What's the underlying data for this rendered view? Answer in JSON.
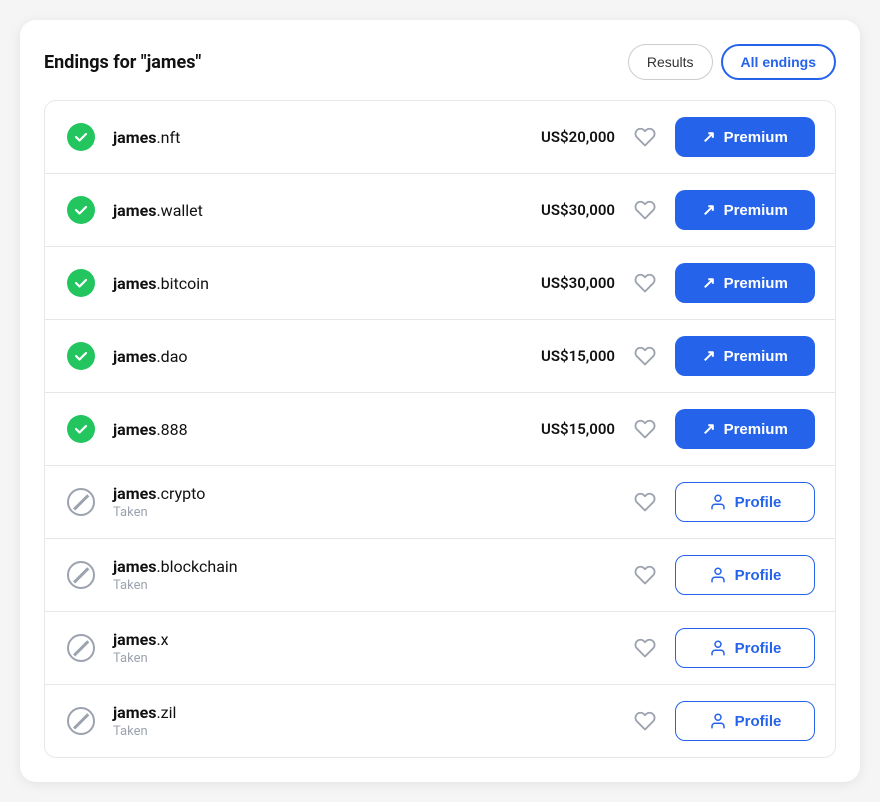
{
  "header": {
    "title_prefix": "Endings for ",
    "search_term": "\"james\"",
    "btn_results": "Results",
    "btn_all_endings": "All endings"
  },
  "domains": [
    {
      "id": "james-nft",
      "name_bold": "james",
      "name_ext": ".nft",
      "available": true,
      "price": "US$20,000",
      "action": "premium"
    },
    {
      "id": "james-wallet",
      "name_bold": "james",
      "name_ext": ".wallet",
      "available": true,
      "price": "US$30,000",
      "action": "premium"
    },
    {
      "id": "james-bitcoin",
      "name_bold": "james",
      "name_ext": ".bitcoin",
      "available": true,
      "price": "US$30,000",
      "action": "premium"
    },
    {
      "id": "james-dao",
      "name_bold": "james",
      "name_ext": ".dao",
      "available": true,
      "price": "US$15,000",
      "action": "premium"
    },
    {
      "id": "james-888",
      "name_bold": "james",
      "name_ext": ".888",
      "available": true,
      "price": "US$15,000",
      "action": "premium"
    },
    {
      "id": "james-crypto",
      "name_bold": "james",
      "name_ext": ".crypto",
      "available": false,
      "status_text": "Taken",
      "price": "",
      "action": "profile"
    },
    {
      "id": "james-blockchain",
      "name_bold": "james",
      "name_ext": ".blockchain",
      "available": false,
      "status_text": "Taken",
      "price": "",
      "action": "profile"
    },
    {
      "id": "james-x",
      "name_bold": "james",
      "name_ext": ".x",
      "available": false,
      "status_text": "Taken",
      "price": "",
      "action": "profile"
    },
    {
      "id": "james-zil",
      "name_bold": "james",
      "name_ext": ".zil",
      "available": false,
      "status_text": "Taken",
      "price": "",
      "action": "profile"
    }
  ],
  "labels": {
    "premium": "Premium",
    "profile": "Profile",
    "taken": "Taken"
  }
}
